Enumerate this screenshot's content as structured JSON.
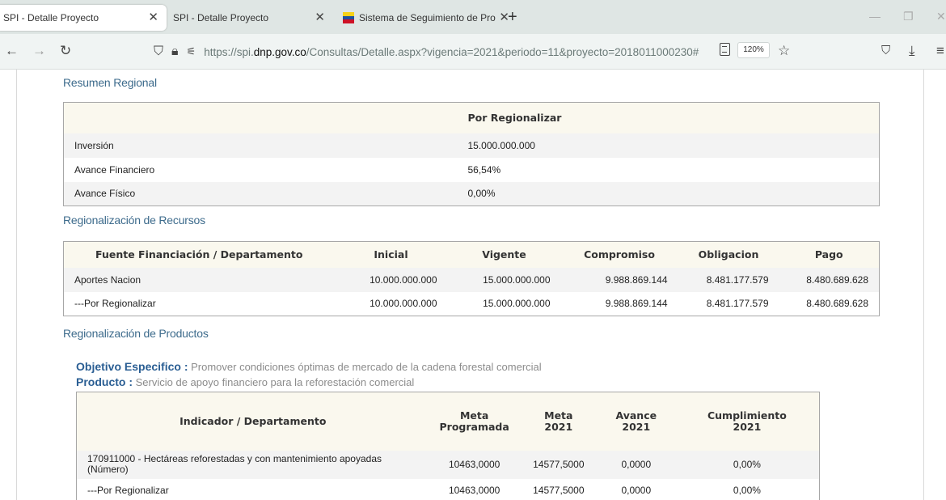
{
  "browser": {
    "tabs": [
      {
        "title": "SPI - Detalle Proyecto",
        "active": true
      },
      {
        "title": "SPI - Detalle Proyecto",
        "active": false
      },
      {
        "title": "Sistema de Seguimiento de Pro",
        "active": false
      }
    ],
    "url_prefix": "https://spi.",
    "url_domain": "dnp.gov.co",
    "url_path": "/Consultas/Detalle.aspx?vigencia=2021&periodo=11&proyecto=2018011000230#",
    "zoom": "120%"
  },
  "colors": {
    "section_title": "#3d6b8c",
    "header_bg": "#faf8ee",
    "label_blue": "#2a5e93"
  },
  "resumen": {
    "title": "Resumen Regional",
    "header": [
      "",
      "Por Regionalizar"
    ],
    "rows": [
      [
        "Inversión",
        "15.000.000.000"
      ],
      [
        "Avance Financiero",
        "56,54%"
      ],
      [
        "Avance Físico",
        "0,00%"
      ]
    ]
  },
  "recursos": {
    "title": "Regionalización de Recursos",
    "header": [
      "Fuente Financiación / Departamento",
      "Inicial",
      "Vigente",
      "Compromiso",
      "Obligacion",
      "Pago"
    ],
    "rows": [
      [
        "Aportes Nacion",
        "10.000.000.000",
        "15.000.000.000",
        "9.988.869.144",
        "8.481.177.579",
        "8.480.689.628"
      ],
      [
        "---Por Regionalizar",
        "10.000.000.000",
        "15.000.000.000",
        "9.988.869.144",
        "8.481.177.579",
        "8.480.689.628"
      ]
    ]
  },
  "productos": {
    "title": "Regionalización de Productos",
    "objetivo_label": "Objetivo Especifico :",
    "objetivo_value": "Promover condiciones óptimas de mercado de la cadena forestal comercial",
    "producto_label": "Producto :",
    "producto_value": "Servicio de apoyo financiero para la reforestación comercial",
    "header": [
      [
        "Indicador / Departamento"
      ],
      [
        "Meta",
        "Programada"
      ],
      [
        "Meta",
        "2021"
      ],
      [
        "Avance",
        "2021"
      ],
      [
        "Cumplimiento",
        "2021"
      ]
    ],
    "rows": [
      [
        "170911000 - Hectáreas reforestadas y con mantenimiento apoyadas (Número)",
        "10463,0000",
        "14577,5000",
        "0,0000",
        "0,00%"
      ],
      [
        "---Por Regionalizar",
        "10463,0000",
        "14577,5000",
        "0,0000",
        "0,00%"
      ]
    ]
  }
}
